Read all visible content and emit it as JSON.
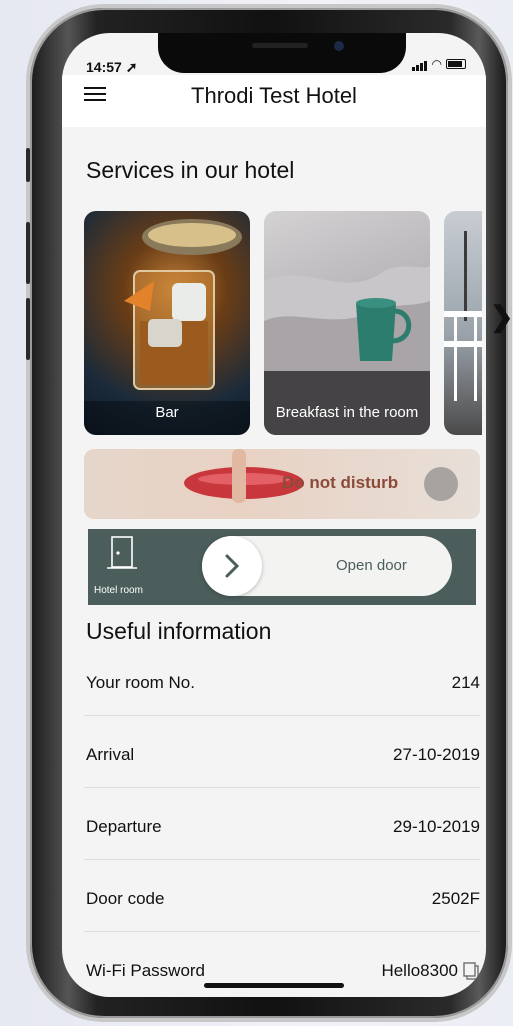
{
  "status_bar": {
    "time": "14:57"
  },
  "header": {
    "title": "Throdi Test Hotel"
  },
  "services": {
    "title": "Services in our hotel",
    "items": [
      {
        "label": "Bar"
      },
      {
        "label": "Breakfast in the room"
      }
    ]
  },
  "do_not_disturb": {
    "label": "Do not disturb"
  },
  "door": {
    "caption": "Hotel room",
    "action": "Open door"
  },
  "useful_info": {
    "title": "Useful information",
    "rows": [
      {
        "label": "Your room No.",
        "value": "214"
      },
      {
        "label": "Arrival",
        "value": "27-10-2019"
      },
      {
        "label": "Departure",
        "value": "29-10-2019"
      },
      {
        "label": "Door code",
        "value": "2502F"
      },
      {
        "label": "Wi-Fi Password",
        "value": "Hello8300"
      }
    ]
  },
  "icons": {
    "menu": "hamburger-menu-icon",
    "next": "chevron-right-icon",
    "door": "door-icon",
    "copy": "copy-icon"
  },
  "colors": {
    "door_panel": "#4b5e5b",
    "dnd_text": "#8b4b3a"
  }
}
